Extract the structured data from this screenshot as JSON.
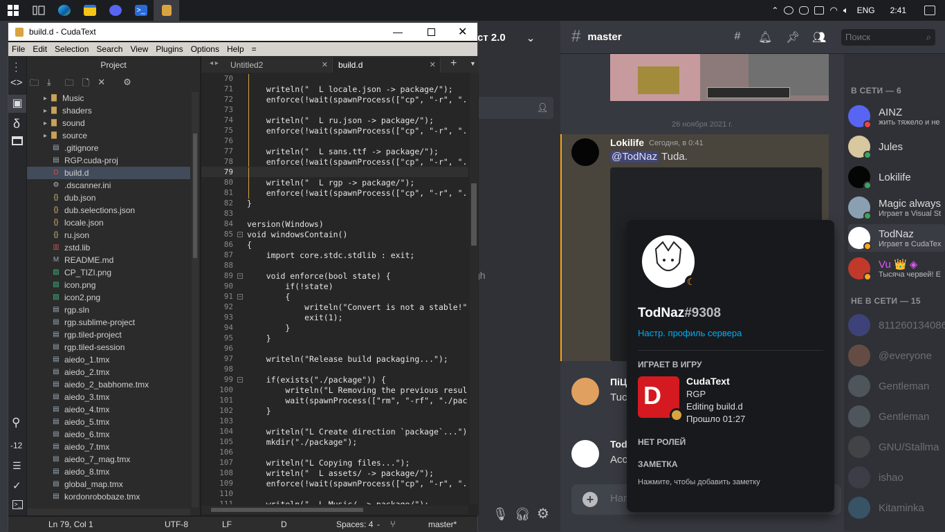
{
  "taskbar": {
    "lang": "ENG",
    "time": "2:41",
    "apps": [
      "start",
      "taskview",
      "edge",
      "explorer",
      "discord",
      "powershell",
      "cudatext"
    ]
  },
  "discord": {
    "guild_name": "ст 2.0",
    "channel": "master",
    "search_placeholder": "Поиск",
    "date_divider": "26 ноября 2021 г.",
    "msg_author": "Lokilife",
    "msg_time": "Сегодня, в 0:41",
    "mention": "@TodNaz",
    "msg_text": " Tuda.",
    "other_author": "ПіЦ",
    "other_text": "Tuc",
    "todnaz_short": "Tod",
    "acc_short": "Acc",
    "partial_ch": "gh",
    "input_placeholder": "Нап",
    "online_header": "В СЕТИ — 6",
    "offline_header": "НЕ В СЕТИ — 15",
    "online": [
      {
        "name": "AINZ",
        "sub": "жить тяжело и не",
        "color": "#5865f2",
        "status": "#ed4245"
      },
      {
        "name": "Jules",
        "sub": "",
        "color": "#d8c8a0",
        "status": "#3ba55d"
      },
      {
        "name": "Lokilife",
        "sub": "",
        "color": "#050505",
        "status": "#3ba55d"
      },
      {
        "name": "Magic always",
        "sub": "Играет в Visual St",
        "color": "#8aa0b0",
        "status": "#3ba55d"
      },
      {
        "name": "TodNaz",
        "sub": "Играет в CudaTex",
        "color": "#ffffff",
        "status": "#faa61a"
      },
      {
        "name": "Vu 👑 ◈",
        "sub": "Тысяча червей! Е",
        "color": "#c0392b",
        "status": "#faa61a",
        "name_color": "#e056fd"
      }
    ],
    "offline": [
      "811260134086",
      "@everyone",
      "Gentleman",
      "Gentleman",
      "GNU/Stallma",
      "ishao",
      "Kitaminka"
    ],
    "popup": {
      "name": "TodNaz",
      "tag": "#9308",
      "server_profile_link": "Настр. профиль сервера",
      "playing_header": "ИГРАЕТ В ИГРУ",
      "game_name": "CudaText",
      "game_line1": "RGP",
      "game_line2": "Editing build.d",
      "game_line3": "Прошло 01:27",
      "roles_header": "НЕТ РОЛЕЙ",
      "note_header": "ЗАМЕТКА",
      "note_placeholder": "Нажмите, чтобы добавить заметку"
    }
  },
  "cudatext": {
    "title": "build.d - CudaText",
    "menu": [
      "File",
      "Edit",
      "Selection",
      "Search",
      "View",
      "Plugins",
      "Options",
      "Help",
      "="
    ],
    "project_title": "Project",
    "tabs": [
      {
        "label": "Untitled2",
        "active": false
      },
      {
        "label": "build.d",
        "active": true
      }
    ],
    "tree": [
      {
        "label": "Music",
        "type": "folder"
      },
      {
        "label": "shaders",
        "type": "folder"
      },
      {
        "label": "sound",
        "type": "folder"
      },
      {
        "label": "source",
        "type": "folder"
      },
      {
        "label": ".gitignore",
        "type": "file"
      },
      {
        "label": "RGP.cuda-proj",
        "type": "file"
      },
      {
        "label": "build.d",
        "type": "d",
        "selected": true
      },
      {
        "label": ".dscanner.ini",
        "type": "gear"
      },
      {
        "label": "dub.json",
        "type": "json"
      },
      {
        "label": "dub.selections.json",
        "type": "json"
      },
      {
        "label": "locale.json",
        "type": "json"
      },
      {
        "label": "ru.json",
        "type": "json"
      },
      {
        "label": "zstd.lib",
        "type": "lib"
      },
      {
        "label": "README.md",
        "type": "md"
      },
      {
        "label": "CP_TIZI.png",
        "type": "img"
      },
      {
        "label": "icon.png",
        "type": "img"
      },
      {
        "label": "icon2.png",
        "type": "img"
      },
      {
        "label": "rgp.sln",
        "type": "file"
      },
      {
        "label": "rgp.sublime-project",
        "type": "file"
      },
      {
        "label": "rgp.tiled-project",
        "type": "file"
      },
      {
        "label": "rgp.tiled-session",
        "type": "file"
      },
      {
        "label": "aiedo_1.tmx",
        "type": "file"
      },
      {
        "label": "aiedo_2.tmx",
        "type": "file"
      },
      {
        "label": "aiedo_2_babhome.tmx",
        "type": "file"
      },
      {
        "label": "aiedo_3.tmx",
        "type": "file"
      },
      {
        "label": "aiedo_4.tmx",
        "type": "file"
      },
      {
        "label": "aiedo_5.tmx",
        "type": "file"
      },
      {
        "label": "aiedo_6.tmx",
        "type": "file"
      },
      {
        "label": "aiedo_7.tmx",
        "type": "file"
      },
      {
        "label": "aiedo_7_mag.tmx",
        "type": "file"
      },
      {
        "label": "aiedo_8.tmx",
        "type": "file"
      },
      {
        "label": "global_map.tmx",
        "type": "file"
      },
      {
        "label": "kordonrobobaze.tmx",
        "type": "file"
      }
    ],
    "current_line": 79,
    "lines": [
      {
        "n": 70,
        "t": ""
      },
      {
        "n": 71,
        "t": "    writeln(\"  L locale.json -> package/\");"
      },
      {
        "n": 72,
        "t": "    enforce(!wait(spawnProcess([\"cp\", \"-r\", \"."
      },
      {
        "n": 73,
        "t": ""
      },
      {
        "n": 74,
        "t": "    writeln(\"  L ru.json -> package/\");"
      },
      {
        "n": 75,
        "t": "    enforce(!wait(spawnProcess([\"cp\", \"-r\", \"."
      },
      {
        "n": 76,
        "t": ""
      },
      {
        "n": 77,
        "t": "    writeln(\"  L sans.ttf -> package/\");"
      },
      {
        "n": 78,
        "t": "    enforce(!wait(spawnProcess([\"cp\", \"-r\", \"."
      },
      {
        "n": 79,
        "t": ""
      },
      {
        "n": 80,
        "t": "    writeln(\"  L rgp -> package/\");"
      },
      {
        "n": 81,
        "t": "    enforce(!wait(spawnProcess([\"cp\", \"-r\", \"."
      },
      {
        "n": 82,
        "t": "}"
      },
      {
        "n": 83,
        "t": ""
      },
      {
        "n": 84,
        "t": "version(Windows)"
      },
      {
        "n": 85,
        "t": "void windowsContain()"
      },
      {
        "n": 86,
        "t": "{"
      },
      {
        "n": 87,
        "t": "    import core.stdc.stdlib : exit;"
      },
      {
        "n": 88,
        "t": ""
      },
      {
        "n": 89,
        "t": "    void enforce(bool state) {"
      },
      {
        "n": 90,
        "t": "        if(!state)"
      },
      {
        "n": 91,
        "t": "        {"
      },
      {
        "n": 92,
        "t": "            writeln(\"Convert is not a stable!\""
      },
      {
        "n": 93,
        "t": "            exit(1);"
      },
      {
        "n": 94,
        "t": "        }"
      },
      {
        "n": 95,
        "t": "    }"
      },
      {
        "n": 96,
        "t": ""
      },
      {
        "n": 97,
        "t": "    writeln(\"Release build packaging...\");"
      },
      {
        "n": 98,
        "t": ""
      },
      {
        "n": 99,
        "t": "    if(exists(\"./package\")) {"
      },
      {
        "n": 100,
        "t": "        writeln(\"L Removing the previous resul"
      },
      {
        "n": 101,
        "t": "        wait(spawnProcess([\"rm\", \"-rf\", \"./pac"
      },
      {
        "n": 102,
        "t": "    }"
      },
      {
        "n": 103,
        "t": ""
      },
      {
        "n": 104,
        "t": "    writeln(\"L Create direction `package`...\")"
      },
      {
        "n": 105,
        "t": "    mkdir(\"./package\");"
      },
      {
        "n": 106,
        "t": ""
      },
      {
        "n": 107,
        "t": "    writeln(\"L Copying files...\");"
      },
      {
        "n": 108,
        "t": "    writeln(\"  L assets/ -> package/\");"
      },
      {
        "n": 109,
        "t": "    enforce(!wait(spawnProcess([\"cp\", \"-r\", \"."
      },
      {
        "n": 110,
        "t": ""
      },
      {
        "n": 111,
        "t": "    writeln(\"  L Music/ -> package/\");"
      }
    ],
    "status": {
      "position": "Ln 79, Col 1",
      "encoding": "UTF-8",
      "eol": "LF",
      "lexer": "D",
      "spaces": "Spaces: 4",
      "dash": "-",
      "branch": "master*",
      "side_label": "-12"
    }
  }
}
